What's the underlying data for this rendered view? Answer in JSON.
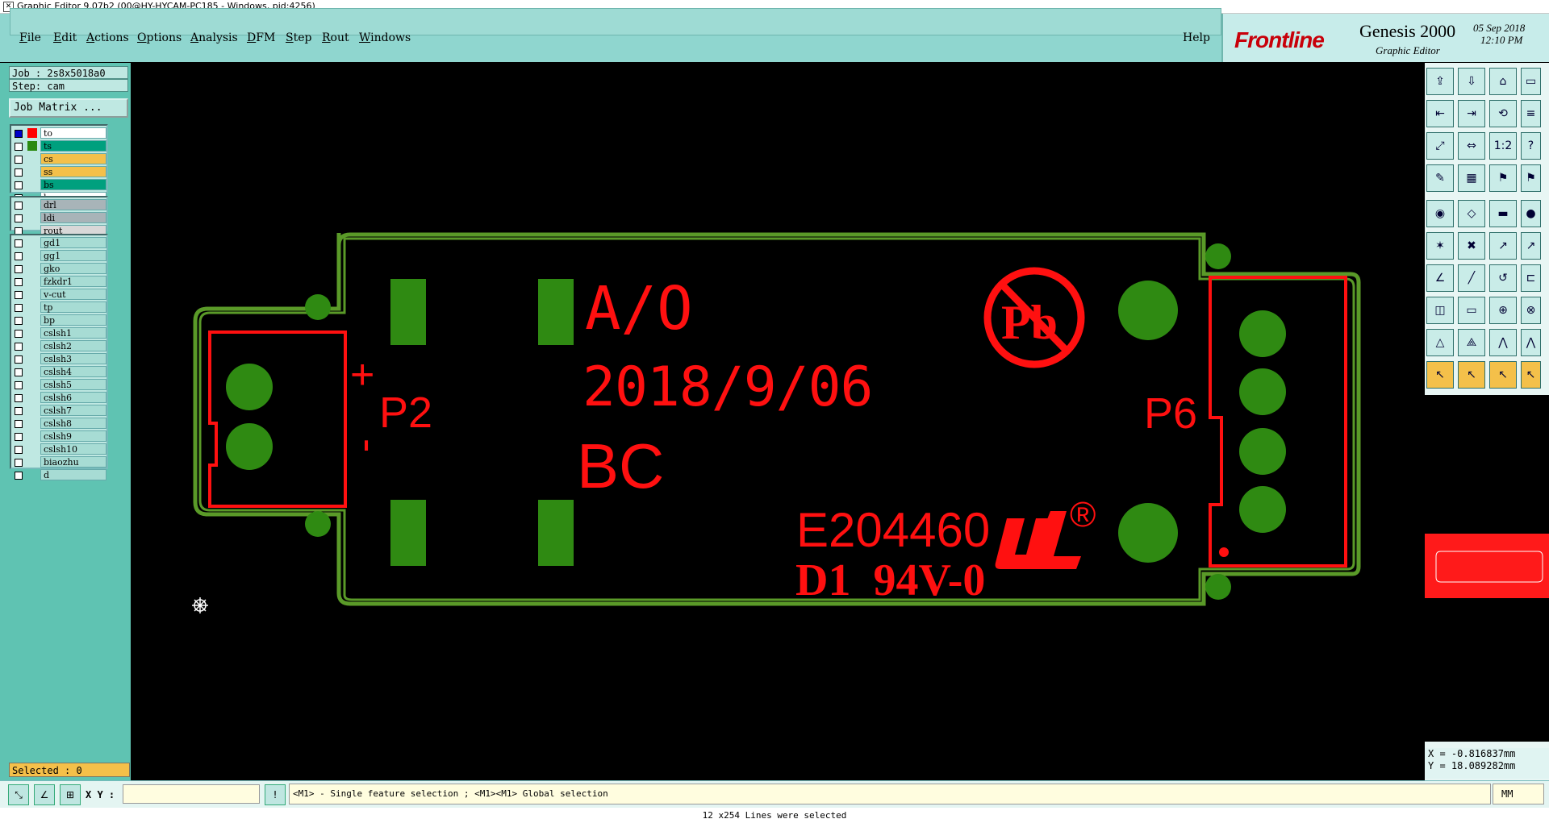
{
  "window": {
    "title": "Graphic Editor 9.07b2 (00@HY-HYCAM-PC185 - Windows, pid:4256)"
  },
  "menu": {
    "items": [
      {
        "key": "F",
        "rest": "ile"
      },
      {
        "key": "E",
        "rest": "dit"
      },
      {
        "key": "A",
        "rest": "ctions"
      },
      {
        "key": "O",
        "rest": "ptions"
      },
      {
        "key": "A",
        "rest": "nalysis"
      },
      {
        "key": "D",
        "rest": "FM"
      },
      {
        "key": "S",
        "rest": "tep"
      },
      {
        "key": "R",
        "rest": "out"
      },
      {
        "key": "W",
        "rest": "indows"
      }
    ],
    "help": "Help"
  },
  "brand": {
    "logo": "Frontline",
    "product": "Genesis 2000",
    "subtitle": "Graphic Editor",
    "date": "05 Sep 2018",
    "time": "12:10 PM"
  },
  "job": {
    "job": "Job : 2s8x5018a0",
    "step": "Step: cam",
    "matrix_button": "Job Matrix ..."
  },
  "layers": {
    "board": [
      {
        "name": "to",
        "color": "#ff0000",
        "bg": "#ffffff",
        "chk": "#0000c8"
      },
      {
        "name": "ts",
        "color": "#2a8a10",
        "bg": "#00a07e",
        "chk": "#ffffff"
      },
      {
        "name": "cs",
        "color": "",
        "bg": "#f4c04a",
        "chk": "#ffffff"
      },
      {
        "name": "ss",
        "color": "",
        "bg": "#f4c04a",
        "chk": "#ffffff"
      },
      {
        "name": "bs",
        "color": "",
        "bg": "#00a07e",
        "chk": "#ffffff"
      },
      {
        "name": "bo",
        "color": "",
        "bg": "#ffffff",
        "chk": "#ffffff"
      }
    ],
    "drill": [
      {
        "name": "drl",
        "bg": "#a8b4b8"
      },
      {
        "name": "ldi",
        "bg": "#a8b4b8"
      },
      {
        "name": "rout",
        "bg": "#d8d8d8"
      }
    ],
    "misc": [
      "gd1",
      "gg1",
      "gko",
      "fzkdr1",
      "v-cut",
      "tp",
      "bp",
      "cslsh1",
      "cslsh2",
      "cslsh3",
      "cslsh4",
      "cslsh5",
      "cslsh6",
      "cslsh7",
      "cslsh8",
      "cslsh9",
      "cslsh10",
      "biaozhu",
      "d"
    ]
  },
  "selected": "Selected : 0",
  "coords": {
    "x": "X = -0.816837mm",
    "y": "Y = 18.089282mm"
  },
  "bottom": {
    "xy_label": "X Y :",
    "xy_value": "",
    "hint": "<M1> - Single feature selection ; <M1><M1> Global selection",
    "units": "MM",
    "status": "12 x254 Lines were selected"
  },
  "pcb": {
    "text_ao": "A/O",
    "text_date": "2018/9/06",
    "text_bc": "BC",
    "text_p2": "P2",
    "text_plus": "+",
    "text_minus": "-",
    "text_p6": "P6",
    "text_e": "E204460",
    "text_d1": "D1  94V-0",
    "text_pb": "Pb",
    "text_reg": "®",
    "colors": {
      "silk": "#ff1010",
      "copper": "#2f8a12",
      "outline": "#5a9a28"
    }
  }
}
